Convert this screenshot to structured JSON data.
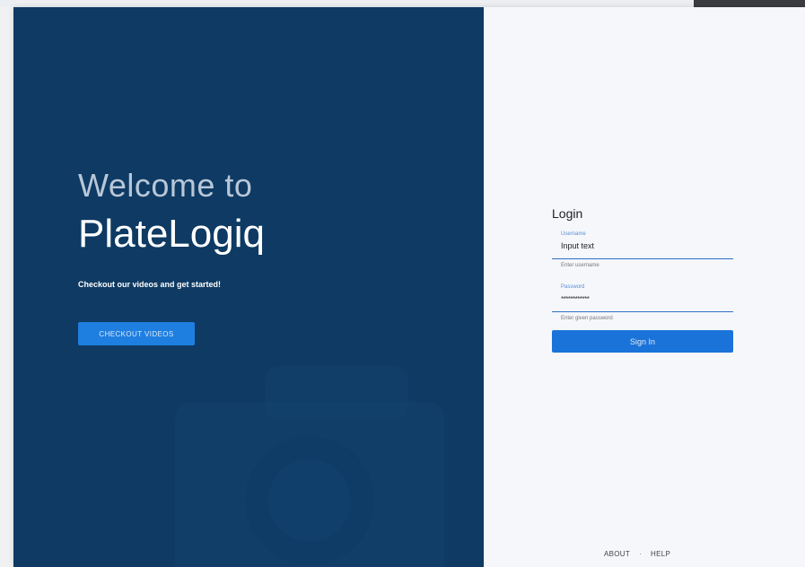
{
  "hero": {
    "welcome": "Welcome to",
    "brand": "PlateLogiq",
    "tagline": "Checkout our videos and get started!",
    "cta_label": "CHECKOUT VIDEOS"
  },
  "login": {
    "heading": "Login",
    "username": {
      "label": "Username",
      "value": "Input text",
      "helper": "Enter username"
    },
    "password": {
      "label": "Password",
      "value": "************",
      "helper": "Enter given password"
    },
    "signin_label": "Sign In"
  },
  "footer": {
    "about": "ABOUT",
    "separator": "·",
    "help": "HELP"
  },
  "colors": {
    "panel_dark": "#0e3a63",
    "accent": "#1a73d9",
    "panel_light": "#f5f7fb"
  },
  "icons": {
    "background_graphic": "camera-icon"
  }
}
